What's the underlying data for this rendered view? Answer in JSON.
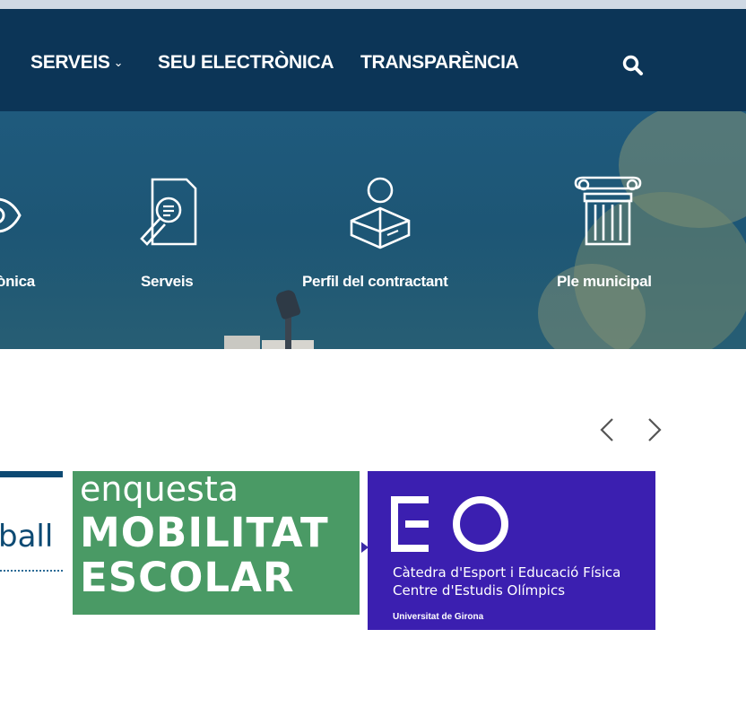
{
  "nav": {
    "items": [
      {
        "label": "SERVEIS",
        "chevron": "⌄"
      },
      {
        "label": "SEU ELECTRÒNICA"
      },
      {
        "label": "TRANSPARÈNCIA"
      }
    ],
    "search_icon": "search-icon"
  },
  "hero": {
    "items": [
      {
        "label": "ònica",
        "icon": "eye-icon"
      },
      {
        "label": "Serveis",
        "icon": "document-search-icon"
      },
      {
        "label": "Perfil del contractant",
        "icon": "person-reading-icon"
      },
      {
        "label": "Ple municipal",
        "icon": "column-icon"
      }
    ]
  },
  "carousel": {
    "prev": "‹",
    "next": "›",
    "banners": [
      {
        "text": "ball"
      },
      {
        "line1": "enquesta",
        "line2": "MOBILITAT",
        "line3": "ESCOLAR"
      },
      {
        "line1": "Càtedra d'Esport i Educació Física",
        "line2": "Centre d'Estudis Olímpics",
        "line3": "Universitat de Girona"
      }
    ]
  },
  "colors": {
    "nav_bg": "#0c3557",
    "banner_green": "#4a9a65",
    "banner_purple": "#3b1fb0",
    "accent_blue": "#0d4a73"
  }
}
